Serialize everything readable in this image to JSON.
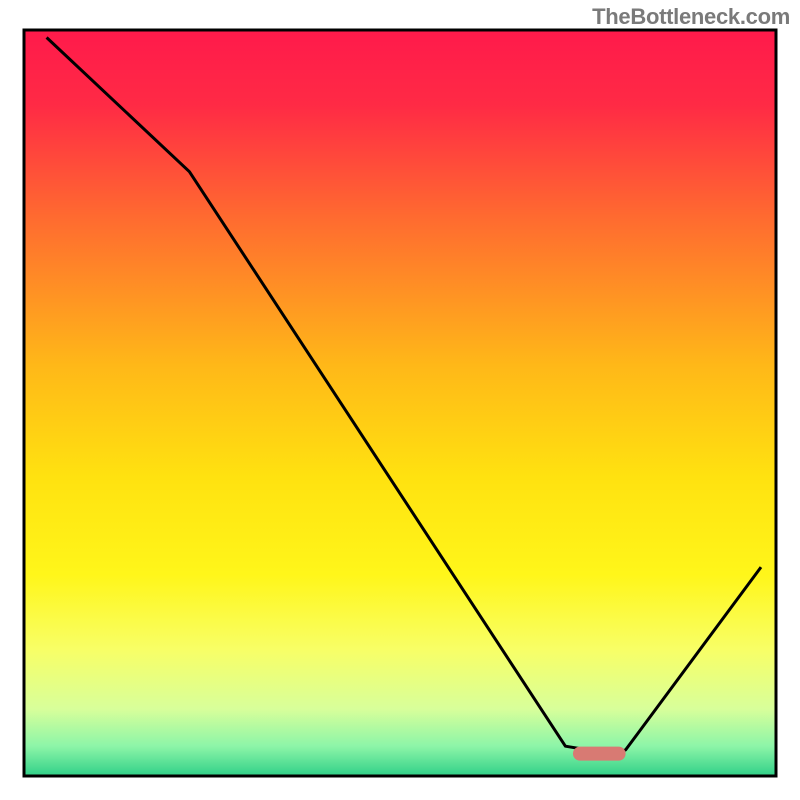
{
  "watermark": "TheBottleneck.com",
  "chart_data": {
    "type": "line",
    "title": "",
    "xlabel": "",
    "ylabel": "",
    "xlim": [
      0,
      100
    ],
    "ylim": [
      0,
      100
    ],
    "x": [
      3,
      22,
      72,
      78,
      80,
      98
    ],
    "values": [
      99,
      81,
      4,
      3,
      3.5,
      28
    ],
    "marker": {
      "x_start": 73,
      "x_end": 80,
      "y": 3,
      "color": "#d87a73"
    },
    "background_gradient": {
      "stops": [
        {
          "offset": 0.0,
          "color": "#ff1a4b"
        },
        {
          "offset": 0.1,
          "color": "#ff2a45"
        },
        {
          "offset": 0.25,
          "color": "#ff6a30"
        },
        {
          "offset": 0.45,
          "color": "#ffb818"
        },
        {
          "offset": 0.6,
          "color": "#ffe210"
        },
        {
          "offset": 0.73,
          "color": "#fff61a"
        },
        {
          "offset": 0.83,
          "color": "#f8ff66"
        },
        {
          "offset": 0.91,
          "color": "#d8ff9a"
        },
        {
          "offset": 0.96,
          "color": "#8df5a8"
        },
        {
          "offset": 1.0,
          "color": "#30d088"
        }
      ]
    }
  }
}
